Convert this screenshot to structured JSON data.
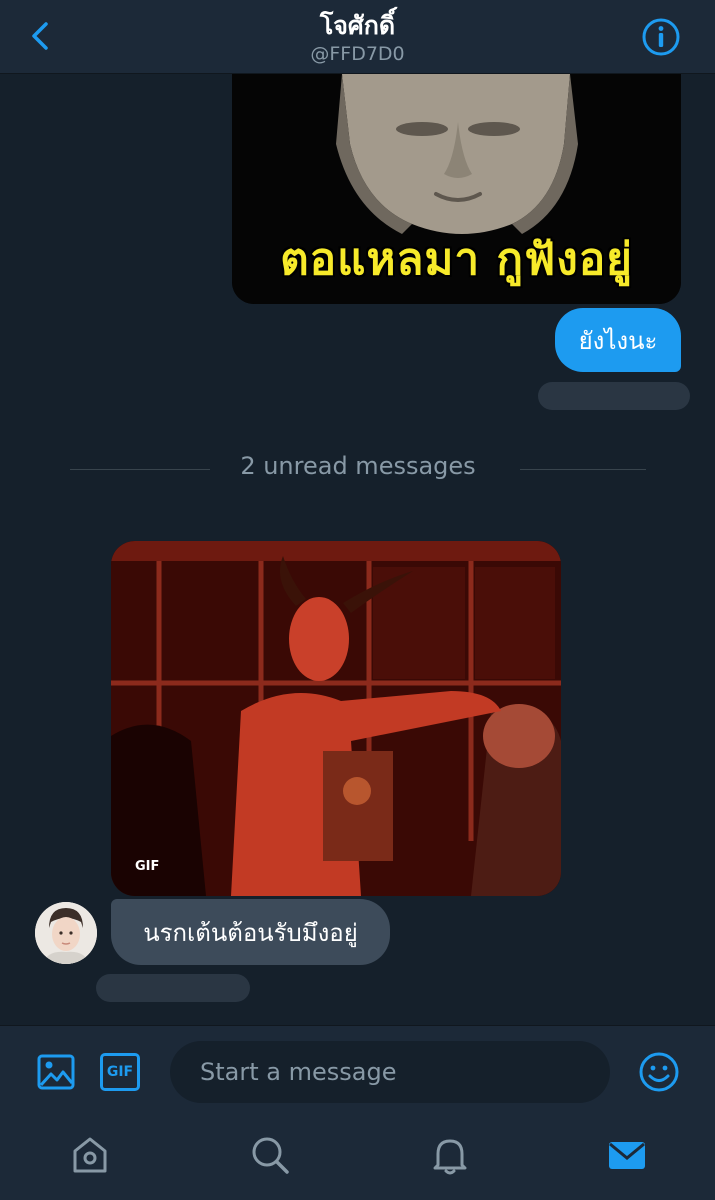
{
  "header": {
    "title": "โจศักดิ์",
    "handle": "@FFD7D0"
  },
  "messages": {
    "outgoing_image_caption": "ตอแหลมา กูฟังอยู่",
    "outgoing_text": "ยังไงนะ",
    "unread_divider": "2 unread messages",
    "incoming_gif_badge": "GIF",
    "incoming_text": "นรกเต้นต้อนรับมึงอยู่"
  },
  "composer": {
    "gif_label": "GIF",
    "placeholder": "Start a message"
  },
  "colors": {
    "accent": "#1d9bf0",
    "background": "#15202b",
    "bar": "#1c2938",
    "incoming_bubble": "#3d4b5a"
  },
  "icons": [
    "back-chevron-icon",
    "info-icon",
    "image-icon",
    "gif-icon",
    "emoji-icon",
    "home-icon",
    "search-icon",
    "bell-icon",
    "mail-icon"
  ]
}
